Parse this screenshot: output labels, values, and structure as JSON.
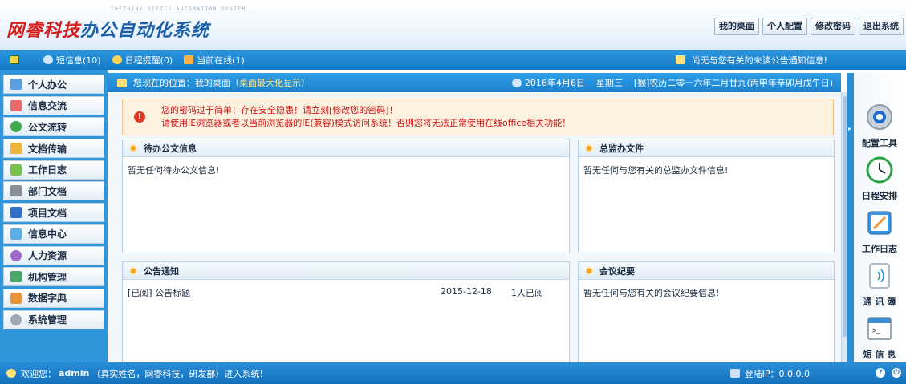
{
  "header": {
    "logo_sub": "INETHINK OFFICE AUTOMATION SYSTEM",
    "logo_red": "网睿科技",
    "logo_blue": "办公自动化系统",
    "buttons": [
      "我的桌面",
      "个人配置",
      "修改密码",
      "退出系统"
    ]
  },
  "infobar": {
    "sms": "短信息(10)",
    "schedule": "日程提醒(0)",
    "online": "当前在线(1)",
    "notice": "尚无与您有关的未读公告通知信息!"
  },
  "sidebar": {
    "items": [
      "个人办公",
      "信息交流",
      "公文流转",
      "文档传输",
      "工作日志",
      "部门文档",
      "项目文档",
      "信息中心",
      "人力资源",
      "机构管理",
      "数据字典",
      "系统管理"
    ]
  },
  "location": {
    "prefix": "您现在的位置：我的桌面（",
    "link": "桌面最大化显示",
    "suffix": "）",
    "date": "2016年4月6日",
    "weekday": "星期三",
    "lunar": "[猴]农历二零一六年二月廿九(丙申年辛卯月戊午日)"
  },
  "alert": {
    "line1": "您的密码过于简单！存在安全隐患！请立刻[修改您的密码]！",
    "line2": "请使用IE浏览器或者以当前浏览器的IE(兼容)模式访问系统！否则您将无法正常使用在线office相关功能！"
  },
  "panels": {
    "pending": {
      "title": "待办公文信息",
      "body": "暂无任何待办公文信息!"
    },
    "supervise": {
      "title": "总监办文件",
      "body": "暂无任何与您有关的总监办文件信息!"
    },
    "notice": {
      "title": "公告通知",
      "rows": [
        {
          "title": "[已阅] 公告标题",
          "date": "2015-12-18",
          "read": "1人已阅"
        }
      ]
    },
    "minutes": {
      "title": "会议纪要",
      "body": "暂无任何与您有关的会议纪要信息!"
    }
  },
  "tools": [
    "配置工具",
    "日程安排",
    "工作日志",
    "通 讯 簿",
    "短 信 息"
  ],
  "footer": {
    "welcome_prefix": "欢迎您：",
    "user": "admin",
    "welcome_suffix": "（真实姓名，网睿科技，研发部）进入系统!",
    "ip": "登陆IP：0.0.0.0"
  }
}
